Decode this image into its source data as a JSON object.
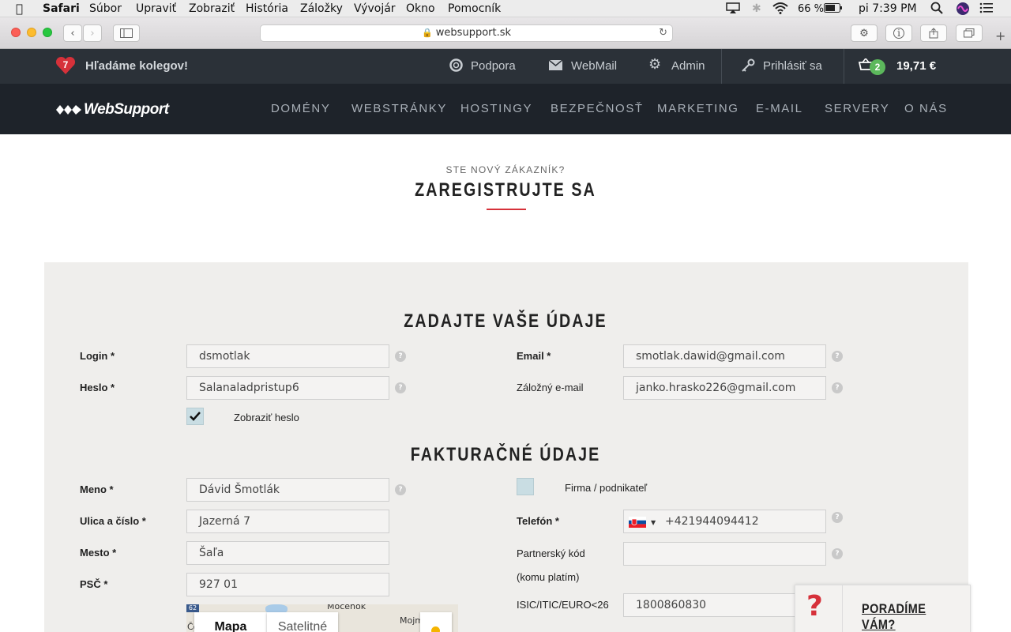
{
  "menubar": {
    "app": "Safari",
    "items": [
      "Súbor",
      "Upraviť",
      "Zobraziť",
      "História",
      "Záložky",
      "Vývojár",
      "Okno",
      "Pomocník"
    ],
    "battery": "66 %",
    "clock": "pi 7:39 PM"
  },
  "browser": {
    "url": "websupport.sk"
  },
  "topbar": {
    "jobs_badge": "7",
    "jobs_text": "Hľadáme kolegov!",
    "support": "Podpora",
    "webmail": "WebMail",
    "admin": "Admin",
    "login": "Prihlásiť sa",
    "cart_count": "2",
    "cart_total": "19,71 €"
  },
  "nav": {
    "logo": "WebSupport",
    "items": [
      "DOMÉNY",
      "WEBSTRÁNKY",
      "HOSTINGY",
      "BEZPEČNOSŤ",
      "MARKETING",
      "E-MAIL",
      "SERVERY",
      "O NÁS"
    ]
  },
  "header": {
    "subtitle": "STE NOVÝ ZÁKAZNÍK?",
    "title": "ZAREGISTRUJTE SA"
  },
  "form": {
    "section1": "ZADAJTE VAŠE ÚDAJE",
    "login_label": "Login *",
    "login_value": "dsmotlak",
    "password_label": "Heslo *",
    "password_value": "Salanaladpristup6",
    "show_password": "Zobraziť heslo",
    "email_label": "Email *",
    "email_value": "smotlak.dawid@gmail.com",
    "backup_email_label": "Záložný e-mail",
    "backup_email_value": "janko.hrasko226@gmail.com",
    "section2": "FAKTURAČNÉ ÚDAJE",
    "name_label": "Meno *",
    "name_value": "Dávid Šmotlák",
    "street_label": "Ulica a číslo *",
    "street_value": "Jazerná 7",
    "city_label": "Mesto *",
    "city_value": "Šaľa",
    "zip_label": "PSČ *",
    "zip_value": "927 01",
    "company_label": "Firma / podnikateľ",
    "phone_label": "Telefón *",
    "phone_value": "+421944094412",
    "partner_label": "Partnerský kód",
    "partner_sub": "(komu platím)",
    "partner_value": "",
    "isic_label": "ISIC/ITIC/EURO<26",
    "isic_value": "1800860830"
  },
  "map": {
    "tab_map": "Mapa",
    "tab_sat": "Satelitné",
    "place1": "Močenok",
    "place2": "Mojm",
    "road": "62",
    "place3": "Čo"
  },
  "help_widget": {
    "label": "PORADÍME VÁM?"
  }
}
